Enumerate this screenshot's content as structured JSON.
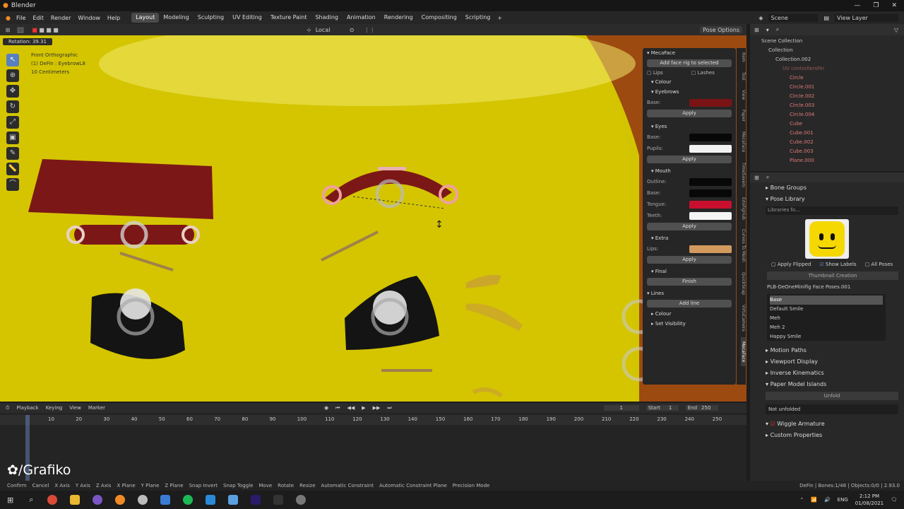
{
  "app": {
    "title": "Blender"
  },
  "menu": [
    "File",
    "Edit",
    "Render",
    "Window",
    "Help"
  ],
  "workspaces": [
    {
      "label": "Layout",
      "active": true
    },
    {
      "label": "Modeling"
    },
    {
      "label": "Sculpting"
    },
    {
      "label": "UV Editing"
    },
    {
      "label": "Texture Paint"
    },
    {
      "label": "Shading"
    },
    {
      "label": "Animation"
    },
    {
      "label": "Rendering"
    },
    {
      "label": "Compositing"
    },
    {
      "label": "Scripting"
    }
  ],
  "top_right": {
    "scene": "Scene",
    "view_layer": "View Layer"
  },
  "viewport": {
    "transform_space": "Local",
    "pose_options": "Pose Options",
    "rotation_readout": "Rotation: 39.31",
    "overlay_lines": [
      "Front Orthographic",
      "(1) DeFin : EyebrowL8",
      "10 Centimeters"
    ]
  },
  "mecaface": {
    "title": "MecaFace",
    "add_rig": "Add face rig to selected",
    "lips": "Lips",
    "lashes": "Lashes",
    "colour": "Colour",
    "eyebrows": "Eyebrows",
    "base": "Base:",
    "apply": "Apply",
    "eyes": "Eyes",
    "pupils": "Pupils:",
    "mouth": "Mouth",
    "outline": "Outline:",
    "tongue": "Tongue:",
    "teeth": "Teeth:",
    "extra": "Extra",
    "lips_label": "Lips:",
    "final": "Final",
    "finish": "Finish",
    "lines": "Lines",
    "add_line": "Add line",
    "set_visibility": "Set Visibility",
    "colors": {
      "eyebrow_base": "#7a1414",
      "eyes_base": "#080808",
      "pupils": "#f2f2f2",
      "outline": "#080808",
      "mouth_base": "#080808",
      "tongue": "#c8102e",
      "teeth": "#f4f4f4",
      "lips": "#d39a5e"
    }
  },
  "side_tabs": [
    "Item",
    "Tool",
    "View",
    "Paper",
    "MecaFace",
    "TimeSavers",
    "EdoFigHub",
    "Curves To Mesh",
    "QuickSnap",
    "VirtuCamera",
    "MecaFace"
  ],
  "outliner": {
    "root": "Scene Collection",
    "items": [
      "Collection",
      "Collection.002",
      "UV controllersFin",
      "Circle",
      "Circle.001",
      "Circle.002",
      "Circle.003",
      "Circle.004",
      "Cube",
      "Cube.001",
      "Cube.002",
      "Cube.003",
      "Plane.000"
    ]
  },
  "properties": {
    "bone_groups": "Bone Groups",
    "pose_library": "Pose Library",
    "libraries_placeholder": "Libraries fo...",
    "apply_flipped": "Apply Flipped",
    "show_labels": "Show Labels",
    "all_poses": "All Poses",
    "thumbnail_creation": "Thumbnail Creation",
    "library_name": "PLB-DeOneMinifig Face Poses.001",
    "poses": [
      "Base",
      "Default Smile",
      "Meh",
      "Meh 2",
      "Happy Smile"
    ],
    "motion_paths": "Motion Paths",
    "viewport_display": "Viewport Display",
    "inverse_kinematics": "Inverse Kinematics",
    "paper_model_islands": "Paper Model Islands",
    "unfold": "Unfold",
    "not_unfolded": "Not unfolded",
    "wiggle_armature": "Wiggle Armature",
    "custom_properties": "Custom Properties"
  },
  "timeline": {
    "menus": [
      "Playback",
      "Keying",
      "View",
      "Marker"
    ],
    "current_frame": "1",
    "start_label": "Start",
    "start": "1",
    "end_label": "End",
    "end": "250",
    "ticks": [
      "10",
      "20",
      "30",
      "40",
      "50",
      "60",
      "70",
      "80",
      "90",
      "100",
      "110",
      "120",
      "130",
      "140",
      "150",
      "160",
      "170",
      "180",
      "190",
      "200",
      "210",
      "220",
      "230",
      "240",
      "250"
    ],
    "watermark": "/Grafiko"
  },
  "statusbar": {
    "items": [
      "Confirm",
      "Cancel",
      "X Axis",
      "Y Axis",
      "Z Axis",
      "X Plane",
      "Y Plane",
      "Z Plane",
      "Snap Invert",
      "Snap Toggle",
      "Move",
      "Rotate",
      "Resize",
      "Automatic Constraint",
      "Automatic Constraint Plane",
      "Precision Mode"
    ],
    "right": "DeFin | Bones:1/48 | Objects:0/0 | 2.93.0"
  },
  "taskbar": {
    "time": "2:12 PM",
    "date": "01/08/2021",
    "lang": "ENG"
  }
}
